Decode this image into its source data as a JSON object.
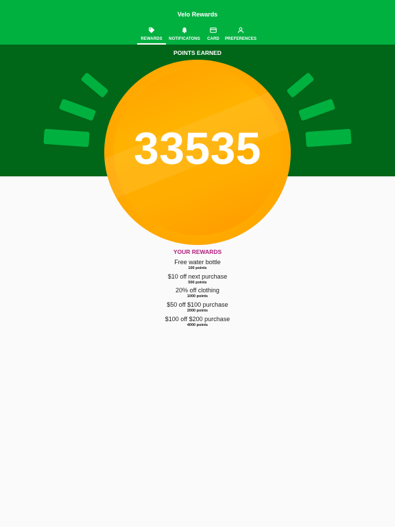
{
  "app": {
    "title": "Velo Rewards"
  },
  "colors": {
    "brand_green": "#00b140",
    "dark_green": "#006618",
    "coin_orange": "#ffab00",
    "accent_magenta": "#b0207d"
  },
  "tabs": [
    {
      "label": "REWARDS",
      "icon": "tag-icon",
      "active": true
    },
    {
      "label": "NOTIFICATONS",
      "icon": "bell-icon",
      "active": false
    },
    {
      "label": "CARD",
      "icon": "card-icon",
      "active": false
    },
    {
      "label": "PREFERENCES",
      "icon": "person-icon",
      "active": false
    }
  ],
  "hero": {
    "label": "POINTS EARNED",
    "points": "33535"
  },
  "rewards": {
    "title": "YOUR REWARDS",
    "items": [
      {
        "name": "Free water bottle",
        "points": "100 points"
      },
      {
        "name": "$10 off next purchase",
        "points": "500 points"
      },
      {
        "name": "20% off clothing",
        "points": "1000 points"
      },
      {
        "name": "$50 off $100 purchase",
        "points": "2000 points"
      },
      {
        "name": "$100 off $200 purchase",
        "points": "4000 points"
      }
    ]
  }
}
